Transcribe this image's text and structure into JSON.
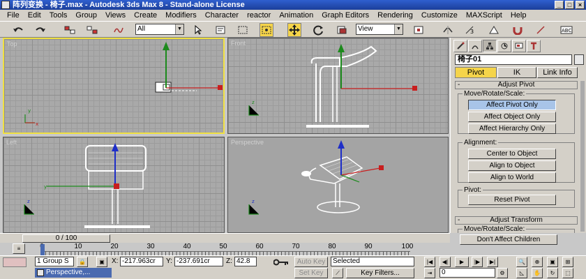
{
  "window": {
    "title": "阵列变换 - 椅子.max - Autodesk 3ds Max 8 - Stand-alone License",
    "controls": [
      "_",
      "□",
      "×"
    ]
  },
  "menu": [
    "File",
    "Edit",
    "Tools",
    "Group",
    "Views",
    "Create",
    "Modifiers",
    "Character",
    "reactor",
    "Animation",
    "Graph Editors",
    "Rendering",
    "Customize",
    "MAXScript",
    "Help"
  ],
  "toolbar": {
    "selection_filter": "All",
    "ref_coord": "View"
  },
  "viewports": {
    "top_label": "Top",
    "front_label": "Front",
    "left_label": "Left",
    "persp_label": "Perspective",
    "axis_labels": {
      "x": "x",
      "y": "y",
      "z": "z"
    }
  },
  "command_panel": {
    "object_name": "椅子01",
    "subtabs": [
      "Pivot",
      "IK",
      "Link Info"
    ],
    "adjust_pivot": {
      "title": "Adjust Pivot",
      "move_group_label": "Move/Rotate/Scale:",
      "buttons": [
        "Affect Pivot Only",
        "Affect Object Only",
        "Affect Hierarchy Only"
      ],
      "alignment_label": "Alignment:",
      "align_buttons": [
        "Center to Object",
        "Align to Object",
        "Align to World"
      ],
      "pivot_label": "Pivot:",
      "reset_pivot": "Reset Pivot"
    },
    "adjust_transform": {
      "title": "Adjust Transform",
      "move_group_label": "Move/Rotate/Scale:",
      "dont_affect": "Don't Affect Children"
    }
  },
  "time_slider": {
    "label": "0 / 100",
    "ticks": [
      "0",
      "10",
      "20",
      "30",
      "40",
      "50",
      "60",
      "70",
      "80",
      "90",
      "100"
    ]
  },
  "status": {
    "selection": "1 Group S",
    "x_label": "X:",
    "x_value": "-217.963cr",
    "y_label": "Y:",
    "y_value": "-237.691cr",
    "z_label": "Z:",
    "z_value": "42.8",
    "auto_key": "Auto Key",
    "set_key": "Set Key",
    "key_mode": "Selected",
    "key_filters": "Key Filters...",
    "frame": "0",
    "taskbar": "Perspective,..."
  }
}
